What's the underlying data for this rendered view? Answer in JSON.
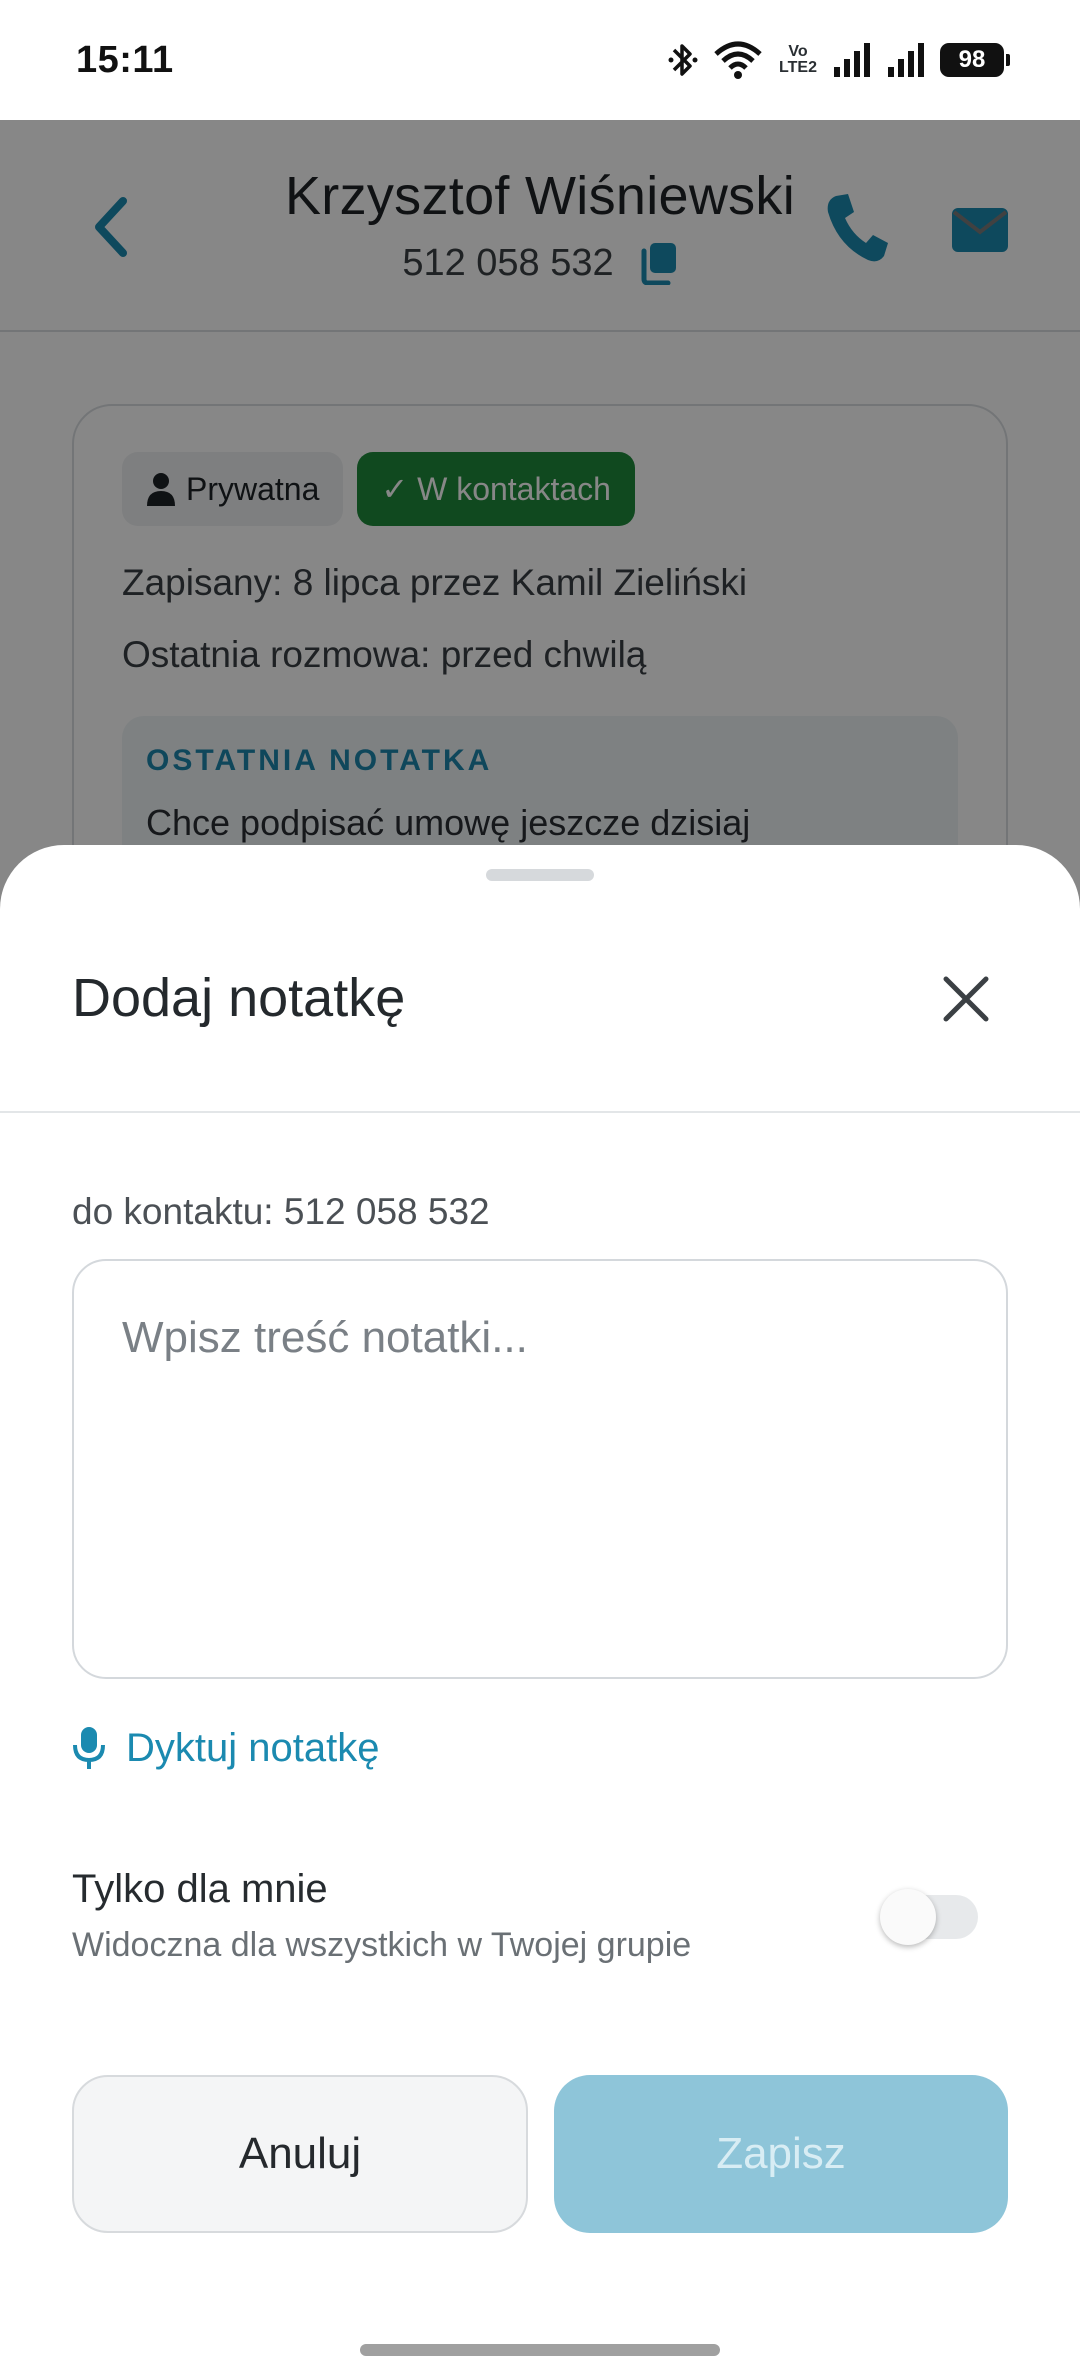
{
  "status_bar": {
    "time": "15:11",
    "network": "Vo LTE2",
    "battery": "98"
  },
  "header": {
    "contact_name": "Krzysztof Wiśniewski",
    "phone": "512 058 532"
  },
  "contact_card": {
    "badge_private": "Prywatna",
    "badge_contacts": "✓ W kontaktach",
    "saved_line": "Zapisany: 8 lipca przez Kamil Zieliński",
    "last_call_line": "Ostatnia rozmowa: przed chwilą",
    "last_note_label": "OSTATNIA NOTATKA",
    "last_note_text": "Chce podpisać umowę jeszcze dzisiaj"
  },
  "sheet": {
    "title": "Dodaj notatkę",
    "to_contact": "do kontaktu: 512 058 532",
    "note_placeholder": "Wpisz treść notatki...",
    "dictate_label": "Dyktuj notatkę",
    "private_title": "Tylko dla mnie",
    "private_subtitle": "Widoczna dla wszystkich w Twojej grupie",
    "private_toggle_on": false,
    "cancel_label": "Anuluj",
    "save_label": "Zapisz"
  },
  "colors": {
    "accent": "#1b8ab0",
    "contacts_badge": "#1f8a3c",
    "save_disabled": "#8ec5d9"
  }
}
